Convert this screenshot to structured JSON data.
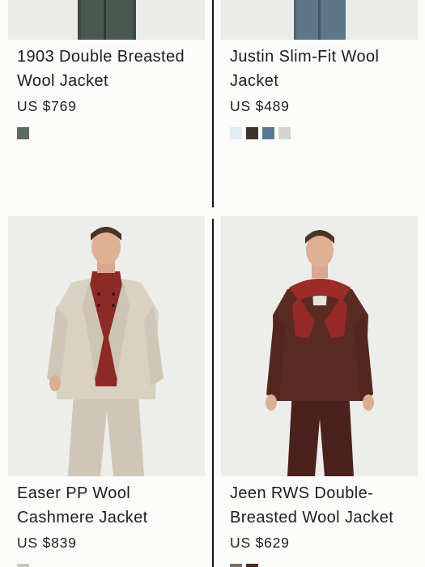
{
  "products": [
    {
      "name": "1903 Double Breasted Wool Jacket",
      "price": "US $769",
      "swatches": [
        "#5b6b64"
      ]
    },
    {
      "name": "Justin Slim-Fit Wool Jacket",
      "price": "US $489",
      "swatches": [
        "#e3ebf3",
        "#3b332d",
        "#5b7892",
        "#d4d4d2"
      ]
    },
    {
      "name": "Easer PP Wool Cashmere Jacket",
      "price": "US $839",
      "swatches": [
        "#c9c8be"
      ]
    },
    {
      "name": "Jeen RWS Double-Breasted Wool Jacket",
      "price": "US $629",
      "swatches": [
        "#7b6f68",
        "#4a2a24"
      ]
    }
  ]
}
